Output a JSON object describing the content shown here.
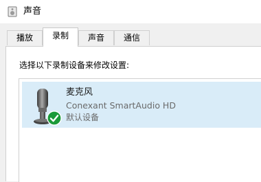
{
  "window": {
    "title": "声音",
    "title_icon": "speaker-icon"
  },
  "tabs": [
    {
      "label": "播放",
      "active": false
    },
    {
      "label": "录制",
      "active": true
    },
    {
      "label": "声音",
      "active": false
    },
    {
      "label": "通信",
      "active": false
    }
  ],
  "recording": {
    "instruction": "选择以下录制设备来修改设置:",
    "devices": [
      {
        "name": "麦克风",
        "driver": "Conexant SmartAudio HD",
        "status": "默认设备",
        "icon": "microphone-icon",
        "badge_icon": "default-checkmark-icon",
        "selected": true
      }
    ]
  },
  "colors": {
    "selection": "#d9ecf8",
    "check_badge": "#1a9a3a"
  }
}
